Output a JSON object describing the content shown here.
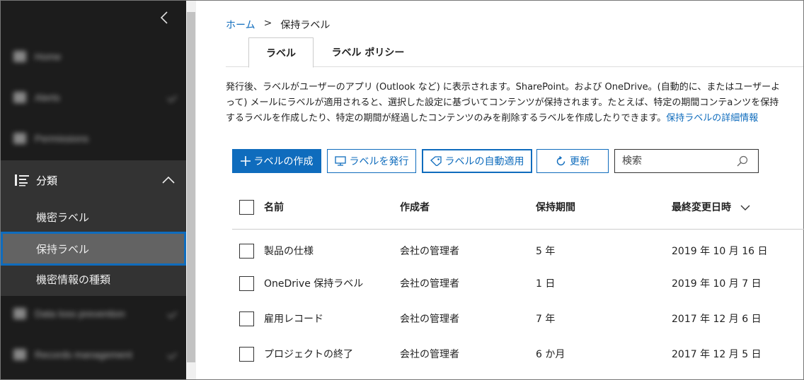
{
  "sidebar": {
    "blurred_items": [
      {
        "label": "Home"
      },
      {
        "label": "Alerts"
      },
      {
        "label": "Permissions"
      }
    ],
    "section": {
      "label": "分類",
      "items": [
        {
          "label": "機密ラベル"
        },
        {
          "label": "保持ラベル"
        },
        {
          "label": "機密情報の種類"
        }
      ]
    },
    "blurred_items_bottom": [
      {
        "label": "Data loss prevention"
      },
      {
        "label": "Records management"
      }
    ]
  },
  "breadcrumb": {
    "home": "ホーム",
    "separator": ">",
    "current": "保持ラベル"
  },
  "tabs": [
    {
      "label": "ラベル"
    },
    {
      "label": "ラベル ポリシー"
    }
  ],
  "description": {
    "text": "発行後、ラベルがユーザーのアプリ (Outlook など) に表示されます。SharePoint。および OneDrive。(自動的に、またはユーザーよって) メールにラベルが適用されると、選択した設定に基づいてコンテンツが保持されます。たとえば、特定の期間コンテaンツを保持するラベルを作成したり、特定の期間が経過したコンテンツのみを削除するラベルを作成したりできます。",
    "link": "保持ラベルの詳細情報"
  },
  "toolbar": {
    "create": "ラベルの作成",
    "publish": "ラベルを発行",
    "auto_apply": "ラベルの自動適用",
    "refresh": "更新",
    "search_placeholder": "検索"
  },
  "table": {
    "columns": [
      "名前",
      "作成者",
      "保持期間",
      "最終変更日時"
    ],
    "rows": [
      {
        "name": "製品の仕様",
        "creator": "会社の管理者",
        "period": "5 年",
        "modified": "2019 年 10 月 16 日"
      },
      {
        "name": "OneDrive 保持ラベル",
        "creator": "会社の管理者",
        "period": "1 日",
        "modified": "2019 年 10 月 7 日"
      },
      {
        "name": "雇用レコード",
        "creator": "会社の管理者",
        "period": "7 年",
        "modified": "2017 年 12 月 6 日"
      },
      {
        "name": "プロジェクトの終了",
        "creator": "会社の管理者",
        "period": "6 か月",
        "modified": "2017 年 12 月 5 日"
      }
    ]
  },
  "colors": {
    "accent": "#0f6cbd",
    "sidebar_bg": "#1c1c1c",
    "section_bg": "#333333",
    "active_item_bg": "#636363"
  }
}
